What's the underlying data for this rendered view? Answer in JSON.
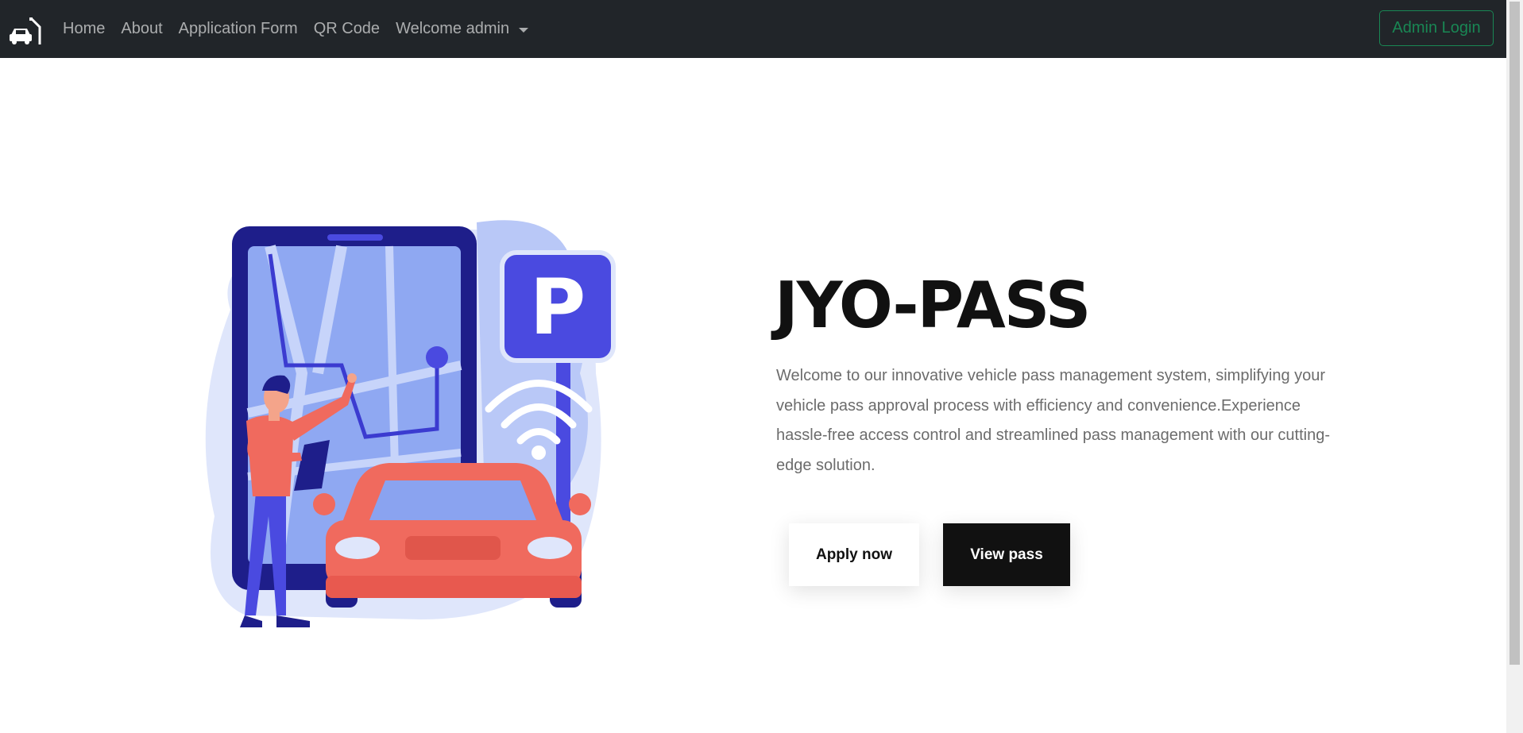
{
  "navbar": {
    "brand_icon": "car-barrier-icon",
    "links": [
      {
        "label": "Home"
      },
      {
        "label": "About"
      },
      {
        "label": "Application Form"
      },
      {
        "label": "QR Code"
      },
      {
        "label": "Welcome admin"
      }
    ],
    "admin_login_label": "Admin Login"
  },
  "hero": {
    "title": "JYO-PASS",
    "description": "Welcome to our innovative vehicle pass management system, simplifying your vehicle pass approval process with efficiency and convenience.Experience hassle-free access control and streamlined pass management with our cutting-edge solution.",
    "apply_label": "Apply now",
    "view_label": "View pass",
    "illustration": "parking-app-illustration",
    "parking_sign_letter": "P"
  },
  "colors": {
    "navbar_bg": "#212529",
    "accent_green": "#198754",
    "illustration_blue": "#4a4ae0",
    "car_red": "#f06a5e"
  }
}
